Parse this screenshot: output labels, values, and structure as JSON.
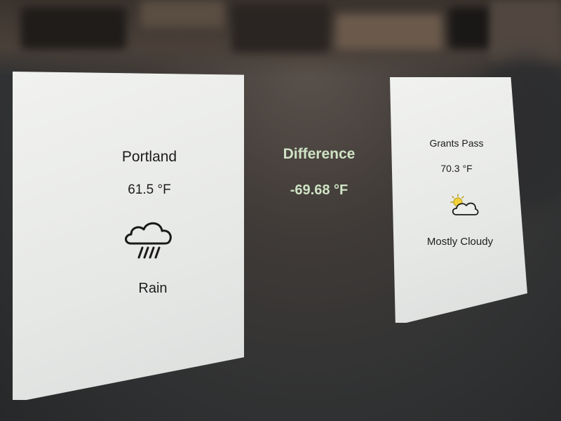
{
  "cities": [
    {
      "city": "Portland",
      "temperature": "61.5 °F",
      "condition": "Rain",
      "icon": "rain-cloud-icon"
    },
    {
      "city": "Grants Pass",
      "temperature": "70.3 °F",
      "condition": "Mostly Cloudy",
      "icon": "partly-cloudy-icon"
    }
  ],
  "difference": {
    "label": "Difference",
    "value": "-69.68 °F"
  },
  "colors": {
    "card_bg": "#eceeec",
    "accent_text": "#cfe3c4",
    "background": "#2f3132"
  }
}
